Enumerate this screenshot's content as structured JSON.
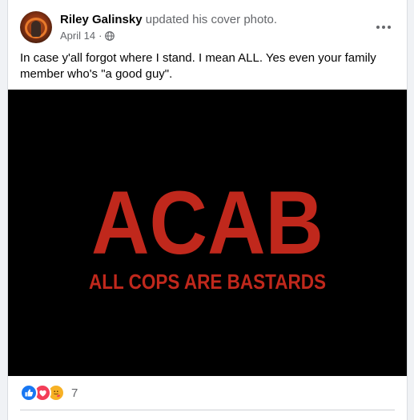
{
  "post": {
    "author": "Riley Galinsky",
    "action": "updated his cover photo.",
    "date": "April 14",
    "dot": "·",
    "privacy_icon": "globe-icon",
    "text": "In case y'all forgot where I stand. I mean ALL. Yes even your family member who's \"a good guy\".",
    "more_icon": "more-options-icon"
  },
  "photo": {
    "big_text": "ACAB",
    "sub_text": "ALL COPS ARE BASTARDS",
    "text_color": "#c0281c",
    "background": "#000000"
  },
  "reactions": {
    "icons": [
      "like-icon",
      "love-icon",
      "care-icon"
    ],
    "count": "7"
  },
  "colors": {
    "like": "#1877f2",
    "love": "#f33e58",
    "care": "#f7b125",
    "secondary_text": "#65676b"
  }
}
